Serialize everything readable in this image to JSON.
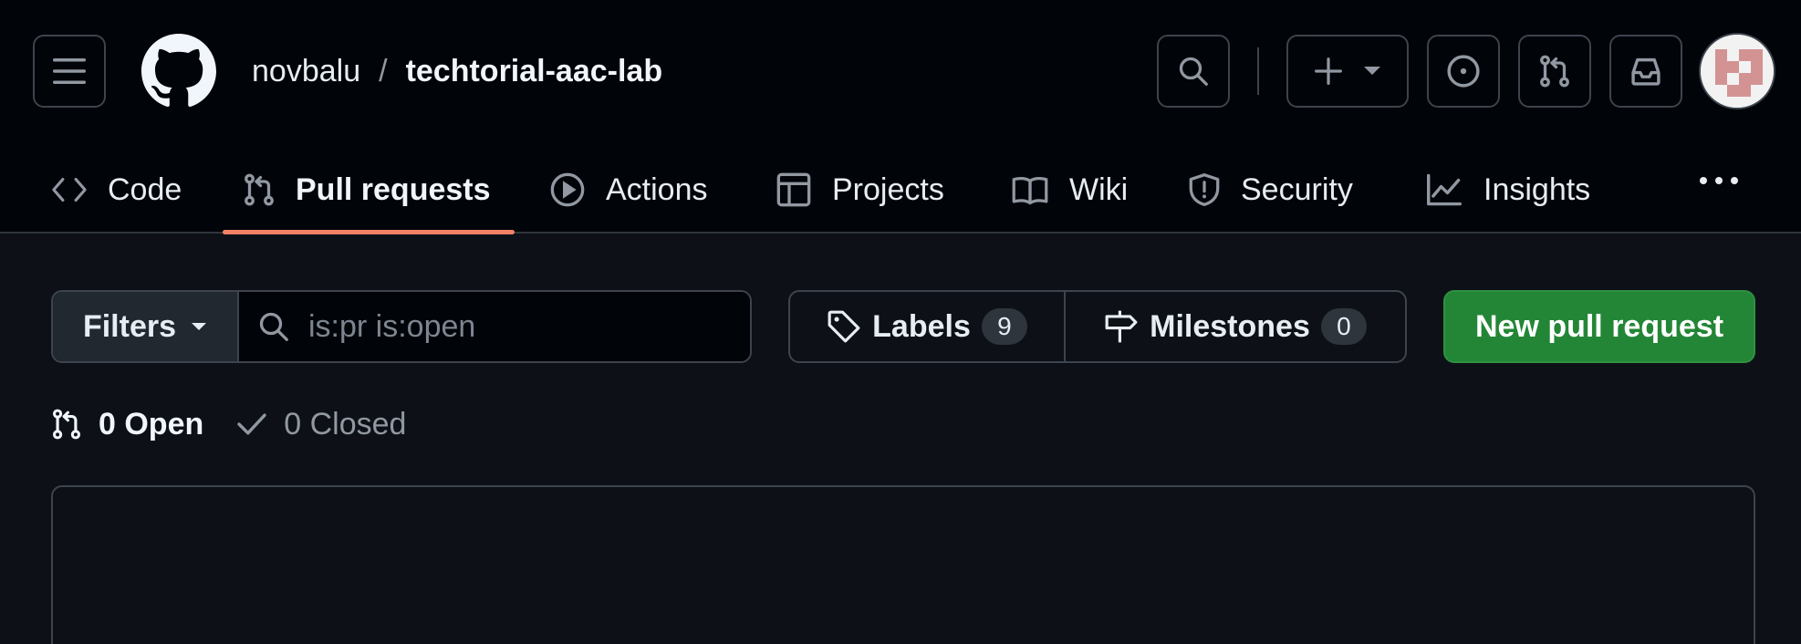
{
  "header": {
    "owner": "novbalu",
    "separator": "/",
    "repo": "techtorial-aac-lab",
    "icons": {
      "menu": "hamburger-menu-icon",
      "logo": "github-logo-icon",
      "search": "search-icon",
      "create": "plus-icon",
      "issues": "issue-opened-icon",
      "pulls": "git-pull-request-icon",
      "inbox": "inbox-icon"
    }
  },
  "nav": {
    "tabs": [
      {
        "label": "Code",
        "icon": "code-icon"
      },
      {
        "label": "Pull requests",
        "icon": "git-pull-request-icon",
        "selected": true
      },
      {
        "label": "Actions",
        "icon": "play-icon"
      },
      {
        "label": "Projects",
        "icon": "table-icon"
      },
      {
        "label": "Wiki",
        "icon": "book-icon"
      },
      {
        "label": "Security",
        "icon": "shield-icon"
      },
      {
        "label": "Insights",
        "icon": "graph-icon"
      }
    ],
    "accent": "#f78166"
  },
  "toolbar": {
    "filters_label": "Filters",
    "search_placeholder": "is:pr is:open",
    "labels_label": "Labels",
    "labels_count": "9",
    "milestones_label": "Milestones",
    "milestones_count": "0",
    "new_pr_label": "New pull request",
    "new_pr_color": "#238636"
  },
  "states": {
    "open_label": "0 Open",
    "closed_label": "0 Closed"
  }
}
